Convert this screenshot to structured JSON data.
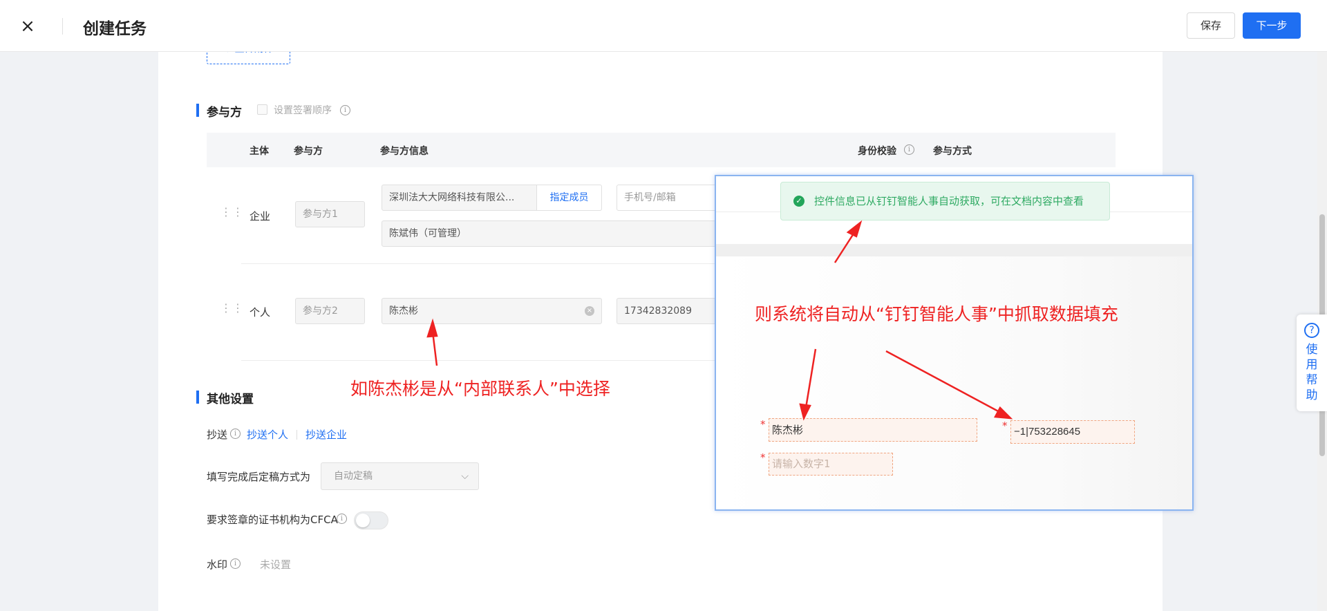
{
  "header": {
    "close_icon": "×",
    "title": "创建任务",
    "save_label": "保存",
    "next_label": "下一步"
  },
  "upload": {
    "label": "⊘ 上传附件"
  },
  "participants": {
    "section_title": "参与方",
    "signing_order_label": "设置签署顺序",
    "info_glyph": "i",
    "columns": [
      "主体",
      "参与方",
      "参与方信息",
      "身份校验",
      "参与方式"
    ],
    "rows": [
      {
        "subject": "企业",
        "party_placeholder": "参与方1",
        "company_value": "深圳法大大网络科技有限公...",
        "assign_label": "指定成员",
        "contact_placeholder": "手机号/邮箱",
        "member_value": "陈斌伟（可管理）"
      },
      {
        "subject": "个人",
        "party_placeholder": "参与方2",
        "name_value": "陈杰彬",
        "clear_glyph": "×",
        "phone_value": "17342832089"
      }
    ]
  },
  "other_settings": {
    "section_title": "其他设置",
    "cc_label": "抄送",
    "cc_person": "抄送个人",
    "cc_company": "抄送企业",
    "finalize_label": "填写完成后定稿方式为",
    "finalize_value": "自动定稿",
    "chevron": "⌵",
    "cfca_label": "要求签章的证书机构为CFCA",
    "cfca_enabled": false,
    "watermark_label": "水印",
    "watermark_value": "未设置"
  },
  "annotations": {
    "left": "如陈杰彬是从“内部联系人”中选择",
    "right": "则系统将自动从“钉钉智能人事”中抓取数据填充"
  },
  "overlay": {
    "toast_icon": "✓",
    "toast_text": "控件信息已从钉钉智能人事自动获取，可在文档内容中查看",
    "name_field_value": "陈杰彬",
    "number_field_value": "−1|753228645",
    "placeholder_field": "请输入数字1",
    "required_mark": "*"
  },
  "help": {
    "icon": "?",
    "label": "使用帮助"
  },
  "colors": {
    "primary": "#1f6ff2",
    "annotation": "#ee2222",
    "success": "#2faa63"
  }
}
